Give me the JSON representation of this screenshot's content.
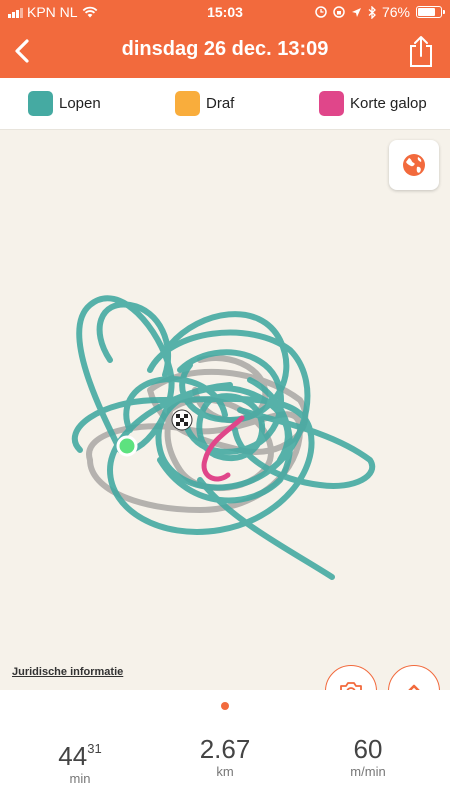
{
  "status_bar": {
    "carrier": "KPN NL",
    "time": "15:03",
    "battery": "76%",
    "battery_level": 0.76
  },
  "header": {
    "title": "dinsdag 26 dec. 13:09",
    "back_icon": "chevron-left-icon",
    "share_icon": "share-icon"
  },
  "legend": [
    {
      "label": "Lopen",
      "color": "#45aaa2"
    },
    {
      "label": "Draf",
      "color": "#f9ad3c"
    },
    {
      "label": "Korte galop",
      "color": "#e0468a"
    }
  ],
  "map": {
    "legal_link": "Juridische informatie",
    "background_color": "#f6f2ea",
    "route_color": "#45aaa2",
    "secondary_route_color": "#a9a7a4",
    "start_marker_color": "#5de27f"
  },
  "pager": {
    "active_index": 0,
    "count": 1
  },
  "stats": {
    "duration_main": "44",
    "duration_sup": "31",
    "duration_unit": "min",
    "distance": "2.67",
    "distance_unit": "km",
    "speed": "60",
    "speed_unit": "m/min"
  }
}
